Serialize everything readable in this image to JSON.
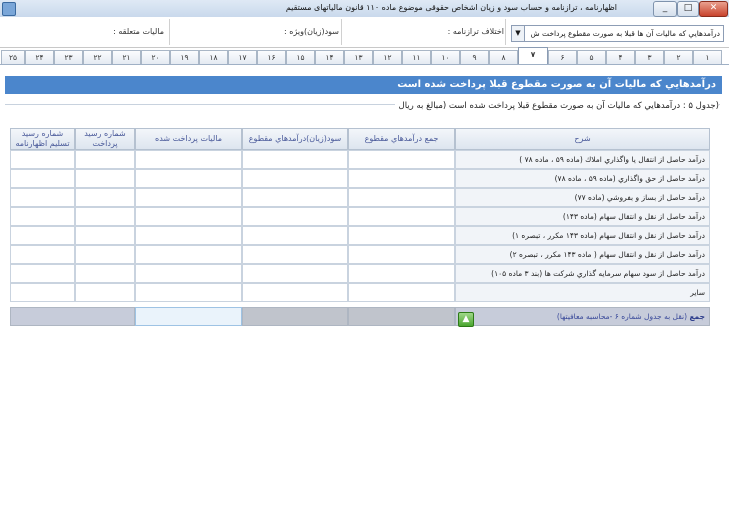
{
  "window": {
    "title": "اظهارنامه ، ترازنامه و حساب سود و زیان اشخاص حقوقی موضوع ماده ۱۱۰ قانون مالیاتهای مستقیم",
    "minimize": "_",
    "maximize": "□",
    "close": "✕"
  },
  "header": {
    "category_select": "درآمدهايي كه ماليات آن ها قبلا به صورت مقطوع پرداخت ش",
    "balance_diff_label": "اختلاف ترازنامه :",
    "special_profit_label": "سود(زيان)ويژه :",
    "assessed_tax_label": "ماليات متعلقه :"
  },
  "tabs": [
    "۱",
    "۲",
    "۳",
    "۴",
    "۵",
    "۶",
    "۷",
    "۸",
    "۹",
    "۱۰",
    "۱۱",
    "۱۲",
    "۱۳",
    "۱۴",
    "۱۵",
    "۱۶",
    "۱۷",
    "۱۸",
    "۱۹",
    "۲۰",
    "۲۱",
    "۲۲",
    "۲۳",
    "۲۴",
    "۲۵"
  ],
  "active_tab": "۷",
  "section": {
    "title": "درآمدهايي كه ماليات آن به صورت مقطوع قبلا پرداخت شده است",
    "caption": "(جدول ۵ : درآمدهايي كه ماليات آن به صورت مقطوع قبلا پرداخت شده است (مبالغ به ريال"
  },
  "table": {
    "headers": {
      "desc": "شرح",
      "total_income": "جمع درآمدهاي مقطوع",
      "profit": "سود(زيان)درآمدهاي مقطوع",
      "tax_paid": "ماليات پرداخت شده",
      "receipt_no": "شماره رسيد پرداخت",
      "return_receipt_no": "شماره رسيد تسليم اظهارنامه"
    },
    "rows": [
      "درآمد حاصل از انتقال يا واگذاري املاك (ماده ۵۹ ، ماده ۷۸ )",
      "درآمد حاصل از حق واگذاري (ماده ۵۹ ، ماده ۷۸)",
      "درآمد حاصل از بساز و بفروشي (ماده ۷۷)",
      "درآمد حاصل از نقل و انتقال سهام (ماده ۱۴۳)",
      "درآمد حاصل از نقل و انتقال سهام (ماده ۱۴۳ مكرر ، تبصره ۱)",
      "درآمد حاصل از نقل و انتقال سهام ( ماده ۱۴۳ مكرر ، تبصره ۲)",
      "درآمد حاصل از سود سهام سرمايه گذاري شركت ها (بند ۳ ماده ۱۰۵)",
      "ساير"
    ],
    "total_label": "جمع",
    "total_note": "(نقل به جدول شماره ۶ -محاسبه معافيتها)"
  },
  "colors": {
    "section_bar": "#4b86cc",
    "header_text": "#4a5a9a",
    "sum_row": "#c7ccda"
  },
  "icons": {
    "transfer": "up-arrow-icon"
  }
}
